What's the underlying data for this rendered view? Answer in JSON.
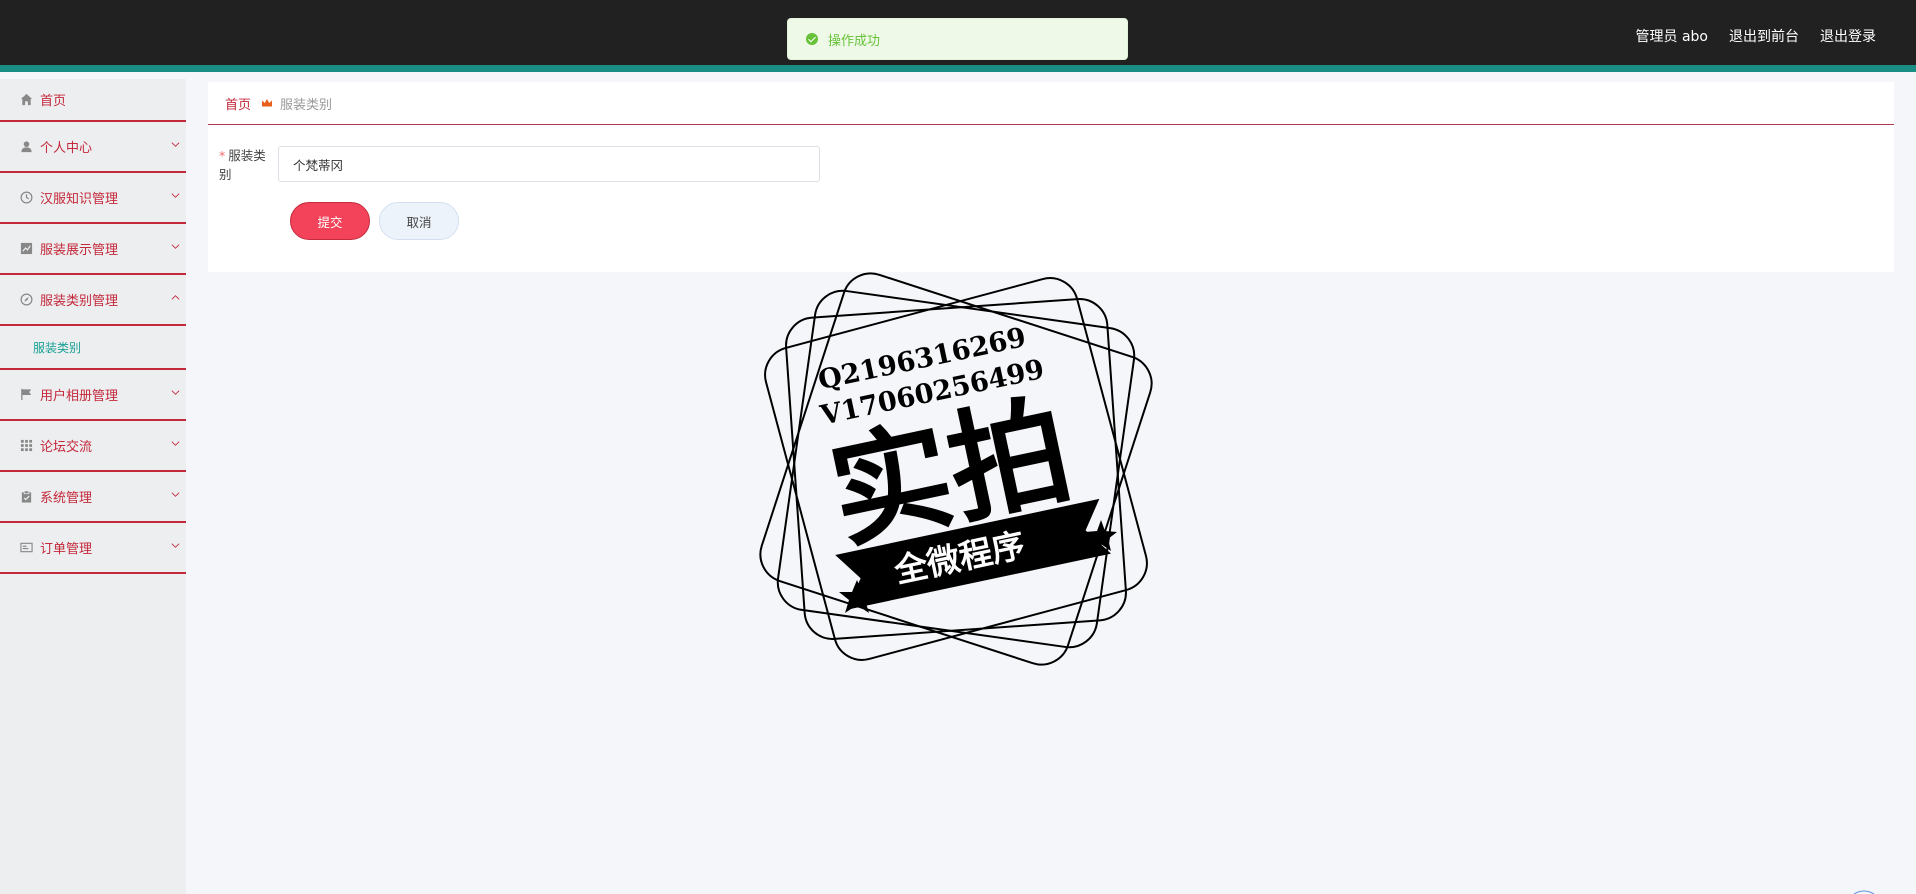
{
  "topbar": {
    "admin_label": "管理员 abo",
    "frontend_link": "退出到前台",
    "logout_link": "退出登录"
  },
  "toast": {
    "message": "操作成功",
    "color": "#67c23a"
  },
  "sidebar": {
    "items": [
      {
        "label": "首页",
        "icon": "home-icon"
      },
      {
        "label": "个人中心",
        "icon": "user-icon"
      },
      {
        "label": "汉服知识管理",
        "icon": "clock-icon"
      },
      {
        "label": "服装展示管理",
        "icon": "chart-icon"
      },
      {
        "label": "服装类别管理",
        "icon": "compass-icon"
      },
      {
        "label": "用户相册管理",
        "icon": "flag-icon"
      },
      {
        "label": "论坛交流",
        "icon": "grid-icon"
      },
      {
        "label": "系统管理",
        "icon": "clipboard-icon"
      },
      {
        "label": "订单管理",
        "icon": "card-icon"
      }
    ],
    "sub_item": "服装类别"
  },
  "breadcrumb": {
    "home": "首页",
    "current": "服装类别"
  },
  "form": {
    "label": "服装类别",
    "required_mark": "*",
    "value": "个梵蒂冈"
  },
  "buttons": {
    "submit": "提交",
    "cancel": "取消"
  },
  "stamp": {
    "line1": "Q2196316269",
    "line2": "V17060256499",
    "main": "实拍",
    "banner": "全微程序"
  },
  "colors": {
    "accent": "#c4283b",
    "teal": "#1a8e85",
    "submit": "#f2435a"
  }
}
